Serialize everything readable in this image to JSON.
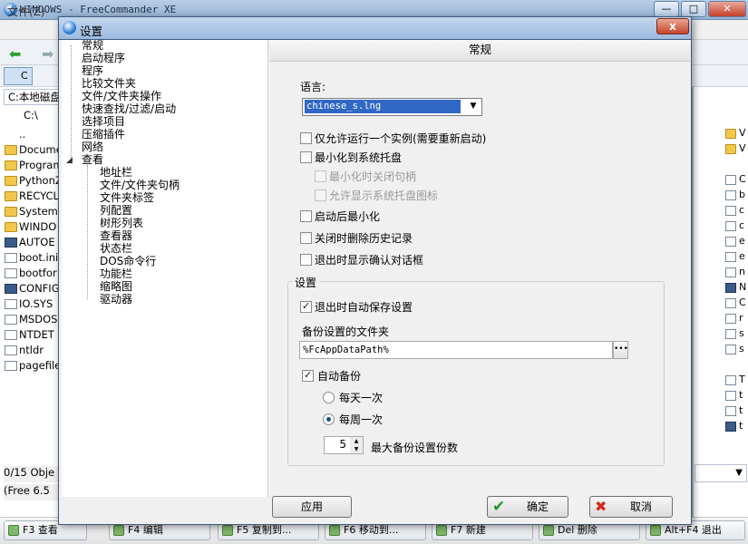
{
  "background_app": {
    "title": "WINDOWS - FreeCommander XE",
    "menu_file": "文件(Z)",
    "drive_c": "C",
    "path_combo": "C:本地磁盘",
    "path_current": "C:\\",
    "parent": "..",
    "files": [
      "Docume",
      "Program",
      "PythonZ",
      "RECYCL",
      "System",
      "WINDO",
      "AUTOE",
      "boot.ini",
      "bootfor",
      "CONFIG",
      "IO.SYS",
      "MSDOS",
      "NTDET",
      "ntldr",
      "pagefile"
    ],
    "status_objects": "0/15 Obje",
    "status_free": "(Free 6.5",
    "right_files": [
      "V",
      "V",
      "",
      "C",
      "b",
      "c",
      "c",
      "e",
      "e",
      "n",
      "N",
      "C",
      "r",
      "s",
      "s",
      "T",
      "t",
      "t",
      "t"
    ],
    "function_keys": [
      "F3 查看",
      "F4 编辑",
      "F5 复制到...",
      "F6 移动到...",
      "F7 新建",
      "Del 删除",
      "Alt+F4 退出"
    ]
  },
  "dialog": {
    "title": "设置",
    "close_label": "x",
    "tree": {
      "items": [
        "常规",
        "启动程序",
        "程序",
        "比较文件夹",
        "文件/文件夹操作",
        "快速查找/过滤/启动",
        "选择项目",
        "压缩插件",
        "网络",
        "查看"
      ],
      "sub_items": [
        "地址栏",
        "文件/文件夹句柄",
        "文件夹标签",
        "列配置",
        "树形列表",
        "查看器",
        "状态栏",
        "DOS命令行",
        "功能栏",
        "缩略图",
        "驱动器"
      ]
    },
    "page_title": "常规",
    "language_label": "语言:",
    "language_value": "chinese_s.lng",
    "options": {
      "single_instance": "仅允许运行一个实例(需要重新启动)",
      "minimize_tray": "最小化到系统托盘",
      "close_handle": "最小化时关闭句柄",
      "allow_tray_icon": "允许显示系统托盘图标",
      "minimize_after_start": "启动后最小化",
      "delete_history": "关闭时删除历史记录",
      "confirm_exit": "退出时显示确认对话框"
    },
    "settings_group": {
      "title": "设置",
      "auto_save": "退出时自动保存设置",
      "backup_folder_label": "备份设置的文件夹",
      "backup_folder_value": "%FcAppDataPath%",
      "auto_backup": "自动备份",
      "daily": "每天一次",
      "weekly": "每周一次",
      "max_backups_value": "5",
      "max_backups_label": "最大备份设置份数"
    },
    "buttons": {
      "apply": "应用",
      "ok": "确定",
      "cancel": "取消"
    }
  },
  "colors": {
    "selection": "#3168c6",
    "ok_icon": "#1f9a2a",
    "cancel_icon": "#d22a1e"
  }
}
